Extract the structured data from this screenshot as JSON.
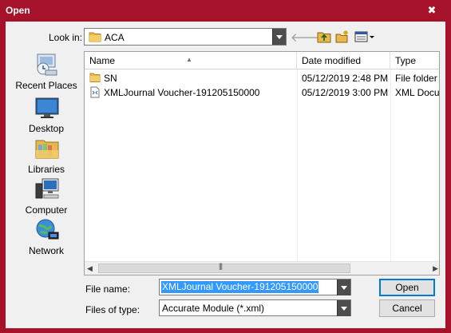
{
  "window": {
    "title": "Open",
    "close_glyph": "✖"
  },
  "lookin": {
    "label": "Look in:",
    "value": "ACA",
    "toolbar_icons": [
      "back-arrow-icon",
      "up-folder-icon",
      "new-folder-icon",
      "view-menu-icon"
    ]
  },
  "places": [
    {
      "label": "Recent Places",
      "icon": "recent-places-icon"
    },
    {
      "label": "Desktop",
      "icon": "desktop-icon"
    },
    {
      "label": "Libraries",
      "icon": "libraries-icon"
    },
    {
      "label": "Computer",
      "icon": "computer-icon"
    },
    {
      "label": "Network",
      "icon": "network-icon"
    }
  ],
  "filelist": {
    "columns": [
      "Name",
      "Date modified",
      "Type"
    ],
    "rows": [
      {
        "name": "SN",
        "date": "05/12/2019 2:48 PM",
        "type": "File folder",
        "icon": "folder-icon"
      },
      {
        "name": "XMLJournal Voucher-191205150000",
        "date": "05/12/2019 3:00 PM",
        "type": "XML Docum",
        "icon": "xml-file-icon"
      }
    ]
  },
  "fields": {
    "filename_label": "File name:",
    "filename_value": "XMLJournal Voucher-191205150000",
    "filetype_label": "Files of type:",
    "filetype_value": "Accurate Module (*.xml)"
  },
  "buttons": {
    "open": "Open",
    "cancel": "Cancel"
  },
  "colors": {
    "frame": "#a5122a",
    "selection": "#3399ff",
    "folder": "#e8b94a"
  }
}
